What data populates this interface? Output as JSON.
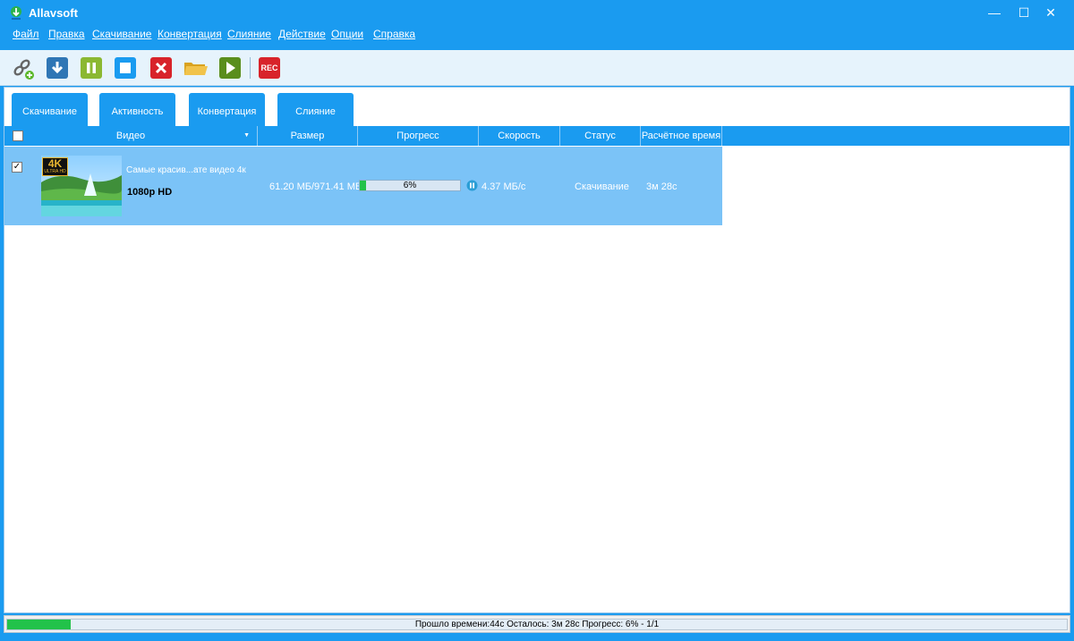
{
  "window": {
    "title": "Allavsoft",
    "min": "—",
    "max": "☐",
    "close": "✕"
  },
  "menu": [
    "Файл",
    "Правка",
    "Скачивание",
    "Конвертация",
    "Слияние",
    "Действие",
    "Опции",
    "Справка"
  ],
  "toolbar": {
    "icons": [
      "add-link-icon",
      "download-icon",
      "pause-icon",
      "stop-icon",
      "delete-icon",
      "folder-icon",
      "play-icon",
      "rec-icon"
    ],
    "rec_label": "REC",
    "colors": {
      "download": "#2f76b5",
      "pause": "#8bb832",
      "stop": "#1a9bf0",
      "delete": "#d8232a",
      "folder": "#e8b530",
      "play": "#5a8e1c",
      "rec": "#d8232a"
    }
  },
  "tabs": [
    "Скачивание",
    "Активность",
    "Конвертация",
    "Слияние"
  ],
  "columns": [
    "Видео",
    "Размер",
    "Прогресс",
    "Скорость",
    "Статус",
    "Расчётное время"
  ],
  "rows": [
    {
      "checked": "✓",
      "thumb_badge": "4K",
      "thumb_badge_sub": "ULTRA HD",
      "title": "Самые красив...ате видео 4к",
      "quality": "1080p HD",
      "size": "61.20 МБ/971.41 МБ",
      "progress": 6,
      "progress_label": "6%",
      "speed": "4.37 МБ/с",
      "status": "Скачивание",
      "eta": "3м 28с"
    }
  ],
  "statusbar": {
    "text": "Прошло времени:44с Осталось: 3м 28с Прогресс: 6% - 1/1",
    "progress": 6
  },
  "accent": "#1a9bf0",
  "row_selected": "#7bc3f7"
}
